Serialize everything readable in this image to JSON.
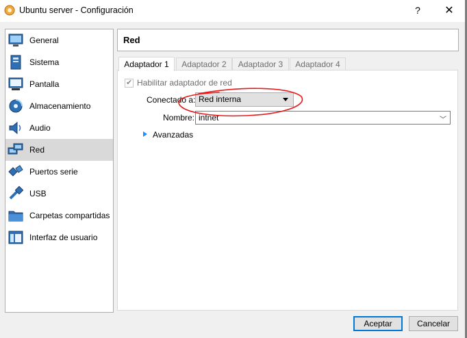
{
  "window": {
    "title": "Ubuntu server - Configuración",
    "help_label": "?",
    "close_label": "✕"
  },
  "sidebar": {
    "items": [
      {
        "label": "General",
        "icon": "general-icon"
      },
      {
        "label": "Sistema",
        "icon": "system-icon"
      },
      {
        "label": "Pantalla",
        "icon": "display-icon"
      },
      {
        "label": "Almacenamiento",
        "icon": "storage-icon"
      },
      {
        "label": "Audio",
        "icon": "audio-icon"
      },
      {
        "label": "Red",
        "icon": "network-icon",
        "selected": true
      },
      {
        "label": "Puertos serie",
        "icon": "serial-ports-icon"
      },
      {
        "label": "USB",
        "icon": "usb-icon"
      },
      {
        "label": "Carpetas compartidas",
        "icon": "shared-folders-icon"
      },
      {
        "label": "Interfaz de usuario",
        "icon": "user-interface-icon"
      }
    ]
  },
  "header": {
    "title": "Red"
  },
  "tabs": [
    {
      "label": "Adaptador 1",
      "active": true
    },
    {
      "label": "Adaptador 2"
    },
    {
      "label": "Adaptador 3"
    },
    {
      "label": "Adaptador 4"
    }
  ],
  "adapter": {
    "enable_label": "Habilitar adaptador de red",
    "enabled": true,
    "connected_label": "Conectado a:",
    "connected_value": "Red interna",
    "name_label": "Nombre:",
    "name_value": "intnet",
    "advanced_label": "Avanzadas"
  },
  "buttons": {
    "accept": "Aceptar",
    "cancel": "Cancelar"
  },
  "colors": {
    "accent": "#0078d7",
    "annotation": "#e8191b",
    "selected_bg": "#d9d9d9"
  }
}
